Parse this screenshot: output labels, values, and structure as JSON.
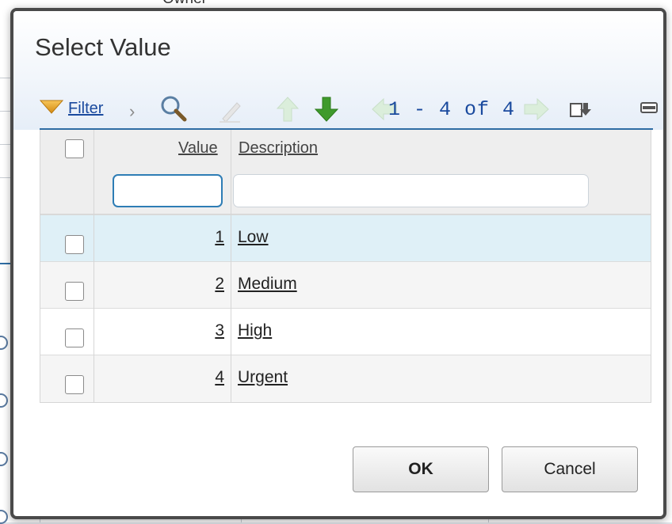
{
  "background": {
    "column_header": "Owner"
  },
  "dialog": {
    "title": "Select Value"
  },
  "toolbar": {
    "filter_label": "Filter",
    "pagination": "1 - 4 of 4",
    "icons": [
      "filter-icon",
      "chevron-right-icon",
      "search-icon",
      "edit-icon",
      "sort-up-icon",
      "sort-down-icon",
      "page-prev-icon",
      "page-next-icon",
      "export-icon",
      "collapse-icon"
    ]
  },
  "grid": {
    "columns": [
      "Value",
      "Description"
    ],
    "filter_value": "",
    "filter_description": "",
    "rows": [
      {
        "value": "1",
        "description": "Low",
        "highlighted": true
      },
      {
        "value": "2",
        "description": "Medium",
        "highlighted": false
      },
      {
        "value": "3",
        "description": "High",
        "highlighted": false
      },
      {
        "value": "4",
        "description": "Urgent",
        "highlighted": false
      }
    ]
  },
  "buttons": {
    "ok": "OK",
    "cancel": "Cancel"
  },
  "colors": {
    "link": "#1a4a9e",
    "accent": "#2e6da4",
    "row_highlight": "#dff0f7",
    "row_alt": "#f5f5f5",
    "arrow_green": "#3f9a2c"
  }
}
